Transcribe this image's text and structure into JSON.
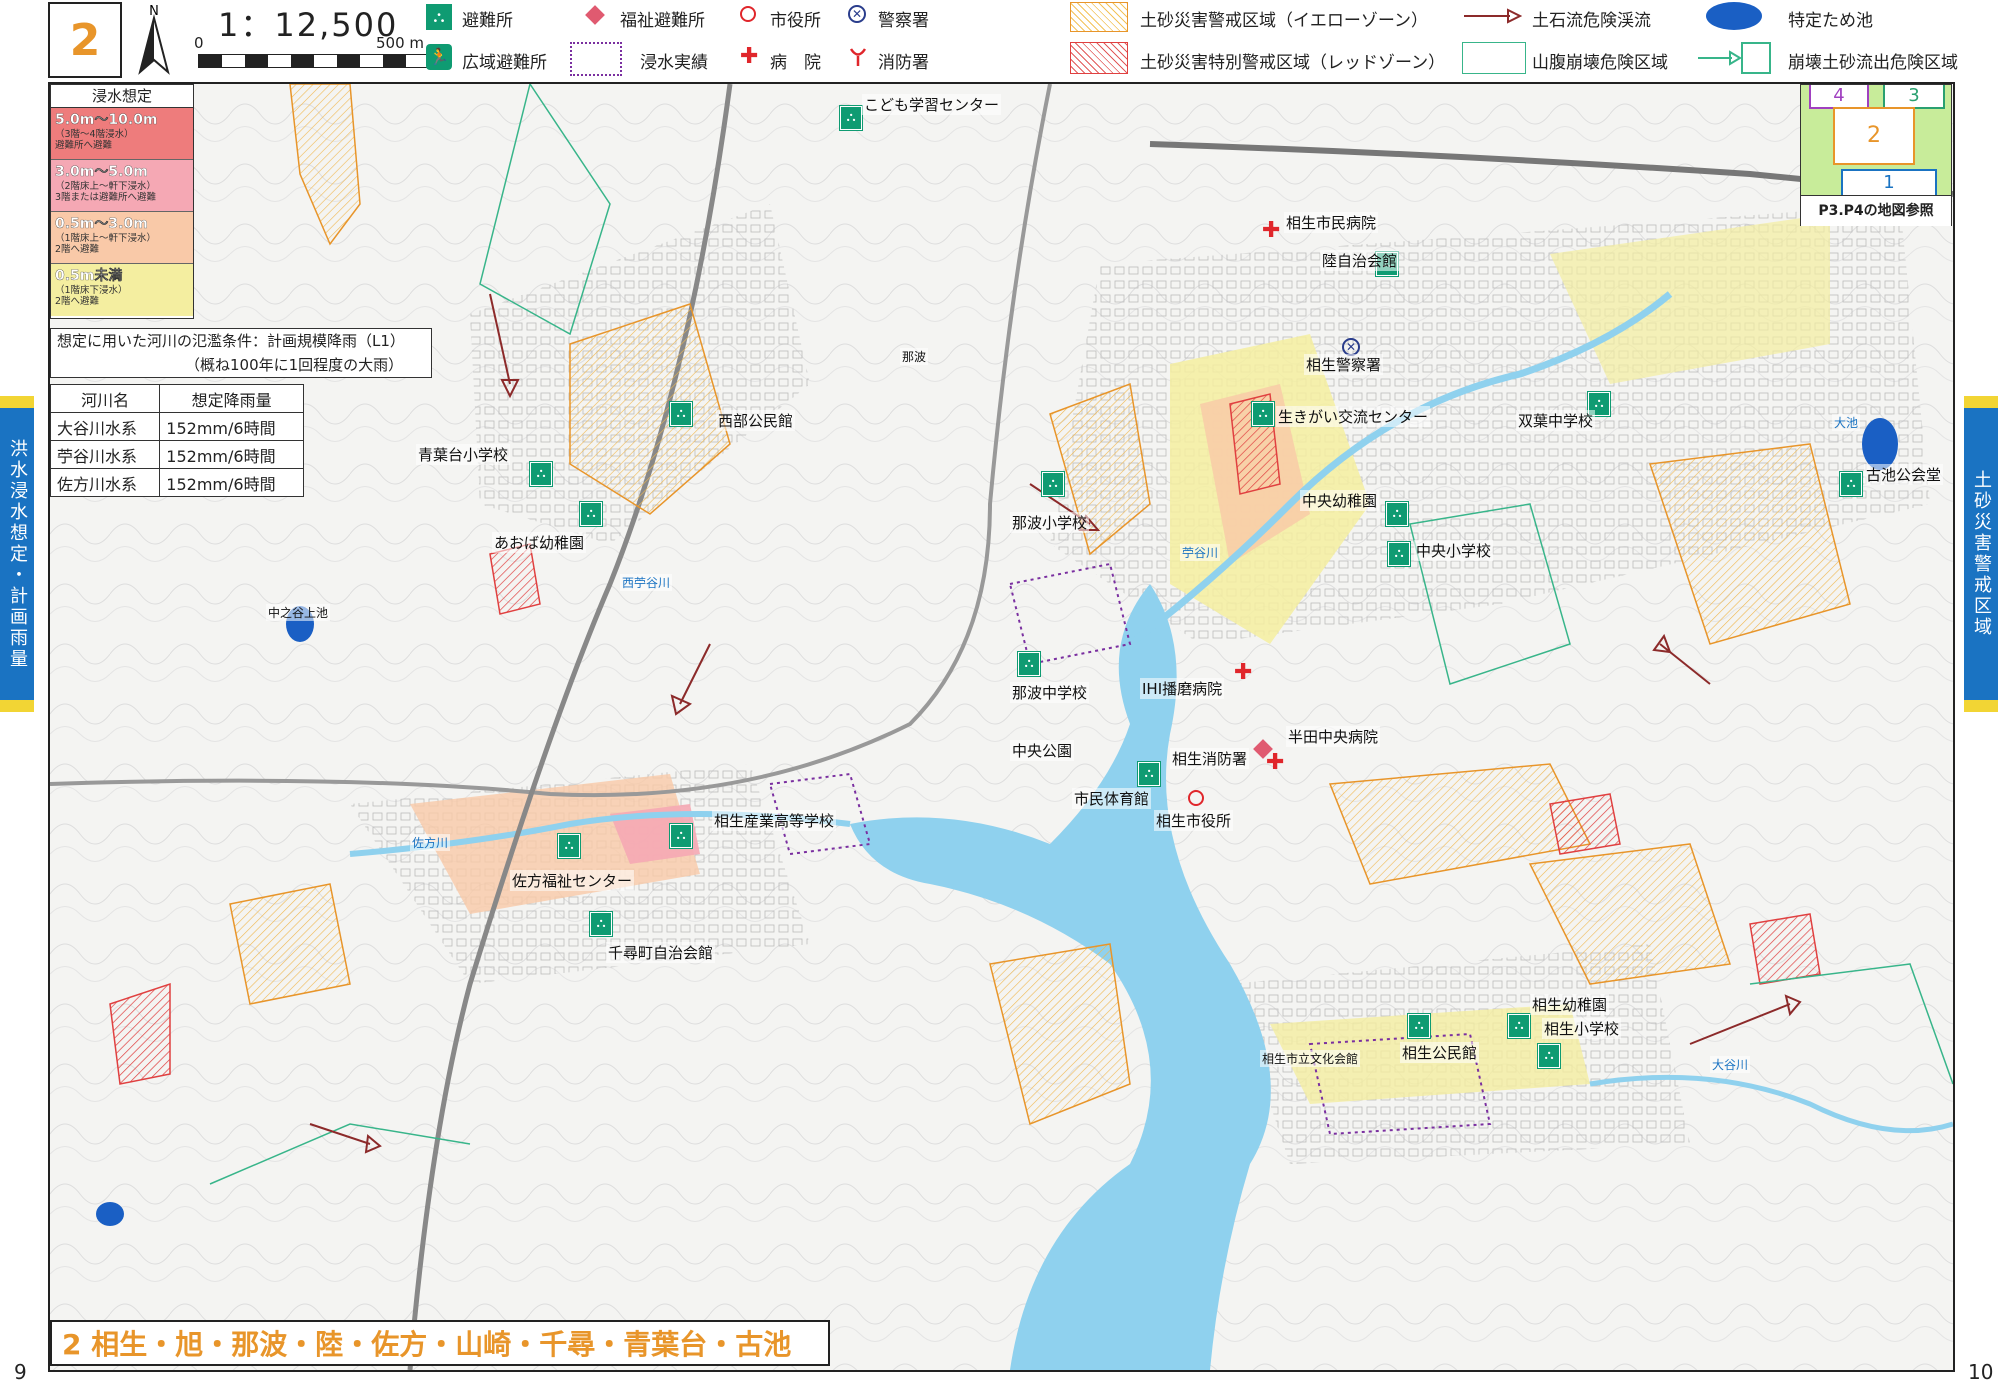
{
  "header": {
    "map_number": "2",
    "north": "N",
    "scale": "1：12,500",
    "scale_zero": "0",
    "scale_end": "500 m"
  },
  "legend": {
    "shelter": "避難所",
    "wide_shelter": "広域避難所",
    "welfare_shelter": "福祉避難所",
    "flood_record": "浸水実績",
    "city_office": "市役所",
    "hospital": "病　院",
    "police": "警察署",
    "fire": "消防署",
    "yellow_zone": "土砂災害警戒区域（イエローゾーン）",
    "red_zone": "土砂災害特別警戒区域（レッドゾーン）",
    "debris_stream": "土石流危険渓流",
    "slope_collapse": "山腹崩壊危険区域",
    "special_pond": "特定ため池",
    "landslide_debris": "崩壊土砂流出危険区域"
  },
  "flood_legend": {
    "title": "浸水想定",
    "levels": [
      {
        "range": "5.0m～10.0m",
        "desc1": "（3階～4階浸水）",
        "desc2": "避難所へ避難",
        "color": "#ee7c7c"
      },
      {
        "range": "3.0m～5.0m",
        "desc1": "（2階床上～軒下浸水）",
        "desc2": "3階または避難所へ避難",
        "color": "#f5a8b4"
      },
      {
        "range": "0.5m～3.0m",
        "desc1": "（1階床上～軒下浸水）",
        "desc2": "2階へ避難",
        "color": "#f9c9a8"
      },
      {
        "range": "0.5m未満",
        "desc1": "（1階床下浸水）",
        "desc2": "2階へ避難",
        "color": "#f4eea0"
      }
    ]
  },
  "conditions": {
    "line1": "想定に用いた河川の氾濫条件：計画規模降雨（L1）",
    "line2": "（概ね100年に1回程度の大雨）"
  },
  "rainfall_table": {
    "headers": [
      "河川名",
      "想定降雨量"
    ],
    "rows": [
      [
        "大谷川水系",
        "152mm/6時間"
      ],
      [
        "苧谷川水系",
        "152mm/6時間"
      ],
      [
        "佐方川水系",
        "152mm/6時間"
      ]
    ]
  },
  "side_tabs": {
    "left": "洪水浸水想定・計画雨量",
    "right": "土砂災害警戒区域"
  },
  "index_map": {
    "cells": [
      "4",
      "3",
      "2",
      "1"
    ],
    "note": "P3.P4の地図参照"
  },
  "map_labels": [
    "こども学習センター",
    "相生市民病院",
    "陸自治会館",
    "相生警察署",
    "生きがい交流センター",
    "双葉中学校",
    "古池公会堂",
    "西部公民館",
    "青葉台小学校",
    "あおば幼稚園",
    "那波小学校",
    "中央幼稚園",
    "中央小学校",
    "那波中学校",
    "IHI播磨病院",
    "半田中央病院",
    "相生消防署",
    "中央公園",
    "市民体育館",
    "相生市役所",
    "相生産業高等学校",
    "佐方福祉センター",
    "千尋町自治会館",
    "相生幼稚園",
    "相生小学校",
    "相生公民館",
    "中之谷上池",
    "那波",
    "佐方川",
    "大谷川",
    "苧谷川",
    "西苧谷川",
    "大池",
    "相生市立文化会館"
  ],
  "area_title": "2 相生・旭・那波・陸・佐方・山崎・千尋・青葉台・古池",
  "page_left": "9",
  "page_right": "10",
  "colors": {
    "sea": "#8fd1ee",
    "shelter_green": "#0f9b72",
    "yellow_zone": "#e8952a",
    "red_zone": "#e04040",
    "slope_green": "#38b58a",
    "debris_arrow": "#8c2a2a",
    "flood_purple": "#7a2fa0",
    "tab_blue": "#1a73c2",
    "title_orange": "#e8952a"
  }
}
